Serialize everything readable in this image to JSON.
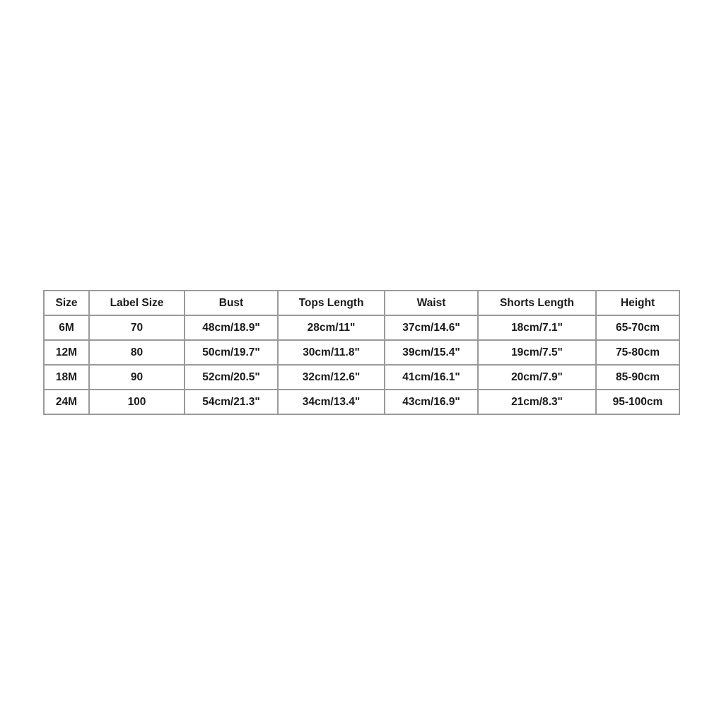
{
  "table": {
    "headers": [
      "Size",
      "Label Size",
      "Bust",
      "Tops Length",
      "Waist",
      "Shorts Length",
      "Height"
    ],
    "rows": [
      [
        "6M",
        "70",
        "48cm/18.9\"",
        "28cm/11\"",
        "37cm/14.6\"",
        "18cm/7.1\"",
        "65-70cm"
      ],
      [
        "12M",
        "80",
        "50cm/19.7\"",
        "30cm/11.8\"",
        "39cm/15.4\"",
        "19cm/7.5\"",
        "75-80cm"
      ],
      [
        "18M",
        "90",
        "52cm/20.5\"",
        "32cm/12.6\"",
        "41cm/16.1\"",
        "20cm/7.9\"",
        "85-90cm"
      ],
      [
        "24M",
        "100",
        "54cm/21.3\"",
        "34cm/13.4\"",
        "43cm/16.9\"",
        "21cm/8.3\"",
        "95-100cm"
      ]
    ]
  }
}
